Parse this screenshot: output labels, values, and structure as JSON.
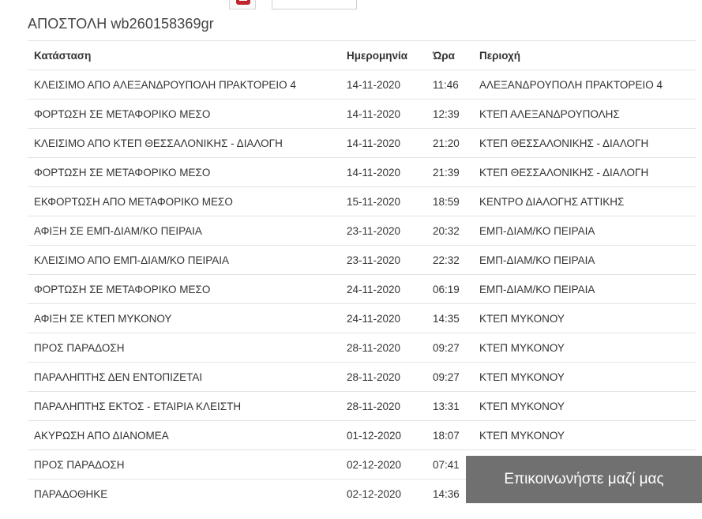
{
  "shipment": {
    "title": "ΑΠΟΣΤΟΛΗ wb260158369gr"
  },
  "table": {
    "headers": {
      "status": "Κατάσταση",
      "date": "Ημερομηνία",
      "time": "Ώρα",
      "area": "Περιοχή"
    },
    "rows": [
      {
        "status": "ΚΛΕΙΣΙΜΟ ΑΠΟ ΑΛΕΞΑΝΔΡΟΥΠΟΛΗ ΠΡΑΚΤΟΡΕΙΟ 4",
        "date": "14-11-2020",
        "time": "11:46",
        "area": "ΑΛΕΞΑΝΔΡΟΥΠΟΛΗ ΠΡΑΚΤΟΡΕΙΟ 4"
      },
      {
        "status": "ΦΟΡΤΩΣΗ ΣΕ ΜΕΤΑΦΟΡΙΚΟ ΜΕΣΟ",
        "date": "14-11-2020",
        "time": "12:39",
        "area": "ΚΤΕΠ ΑΛΕΞΑΝΔΡΟΥΠΟΛΗΣ"
      },
      {
        "status": "ΚΛΕΙΣΙΜΟ ΑΠΟ ΚΤΕΠ ΘΕΣΣΑΛΟΝΙΚΗΣ - ΔΙΑΛΟΓΗ",
        "date": "14-11-2020",
        "time": "21:20",
        "area": "ΚΤΕΠ ΘΕΣΣΑΛΟΝΙΚΗΣ - ΔΙΑΛΟΓΗ"
      },
      {
        "status": "ΦΟΡΤΩΣΗ ΣΕ ΜΕΤΑΦΟΡΙΚΟ ΜΕΣΟ",
        "date": "14-11-2020",
        "time": "21:39",
        "area": "ΚΤΕΠ ΘΕΣΣΑΛΟΝΙΚΗΣ - ΔΙΑΛΟΓΗ"
      },
      {
        "status": "ΕΚΦΟΡΤΩΣΗ ΑΠΟ ΜΕΤΑΦΟΡΙΚΟ ΜΕΣΟ",
        "date": "15-11-2020",
        "time": "18:59",
        "area": "ΚΕΝΤΡΟ ΔΙΑΛΟΓΗΣ ΑΤΤΙΚΗΣ"
      },
      {
        "status": "ΑΦΙΞΗ ΣΕ ΕΜΠ-ΔΙΑΜ/ΚΟ ΠΕΙΡΑΙΑ",
        "date": "23-11-2020",
        "time": "20:32",
        "area": "ΕΜΠ-ΔΙΑΜ/ΚΟ ΠΕΙΡΑΙΑ"
      },
      {
        "status": "ΚΛΕΙΣΙΜΟ ΑΠΟ ΕΜΠ-ΔΙΑΜ/ΚΟ ΠΕΙΡΑΙΑ",
        "date": "23-11-2020",
        "time": "22:32",
        "area": "ΕΜΠ-ΔΙΑΜ/ΚΟ ΠΕΙΡΑΙΑ"
      },
      {
        "status": "ΦΟΡΤΩΣΗ ΣΕ ΜΕΤΑΦΟΡΙΚΟ ΜΕΣΟ",
        "date": "24-11-2020",
        "time": "06:19",
        "area": "ΕΜΠ-ΔΙΑΜ/ΚΟ ΠΕΙΡΑΙΑ"
      },
      {
        "status": "ΑΦΙΞΗ ΣΕ ΚΤΕΠ ΜΥΚΟΝΟΥ",
        "date": "24-11-2020",
        "time": "14:35",
        "area": "ΚΤΕΠ ΜΥΚΟΝΟΥ"
      },
      {
        "status": "ΠΡΟΣ ΠΑΡΑΔΟΣΗ",
        "date": "28-11-2020",
        "time": "09:27",
        "area": "ΚΤΕΠ ΜΥΚΟΝΟΥ"
      },
      {
        "status": "ΠΑΡΑΛΗΠΤΗΣ ΔΕΝ ΕΝΤΟΠΙΖΕΤΑΙ",
        "date": "28-11-2020",
        "time": "09:27",
        "area": "ΚΤΕΠ ΜΥΚΟΝΟΥ"
      },
      {
        "status": "ΠΑΡΑΛΗΠΤΗΣ ΕΚΤΟΣ - ΕΤΑΙΡΙΑ ΚΛΕΙΣΤΗ",
        "date": "28-11-2020",
        "time": "13:31",
        "area": "ΚΤΕΠ ΜΥΚΟΝΟΥ"
      },
      {
        "status": "ΑΚΥΡΩΣΗ ΑΠΟ ΔΙΑΝΟΜΕΑ",
        "date": "01-12-2020",
        "time": "18:07",
        "area": "ΚΤΕΠ ΜΥΚΟΝΟΥ"
      },
      {
        "status": "ΠΡΟΣ ΠΑΡΑΔΟΣΗ",
        "date": "02-12-2020",
        "time": "07:41",
        "area": ""
      },
      {
        "status": "ΠΑΡΑΔΟΘΗΚΕ",
        "date": "02-12-2020",
        "time": "14:36",
        "area": ""
      }
    ]
  },
  "contact": {
    "label": "Επικοινωνήστε μαζί μας"
  },
  "icons": {
    "print": "printer-icon"
  },
  "colors": {
    "accent_red": "#c0262f",
    "contact_bg": "#707070"
  }
}
